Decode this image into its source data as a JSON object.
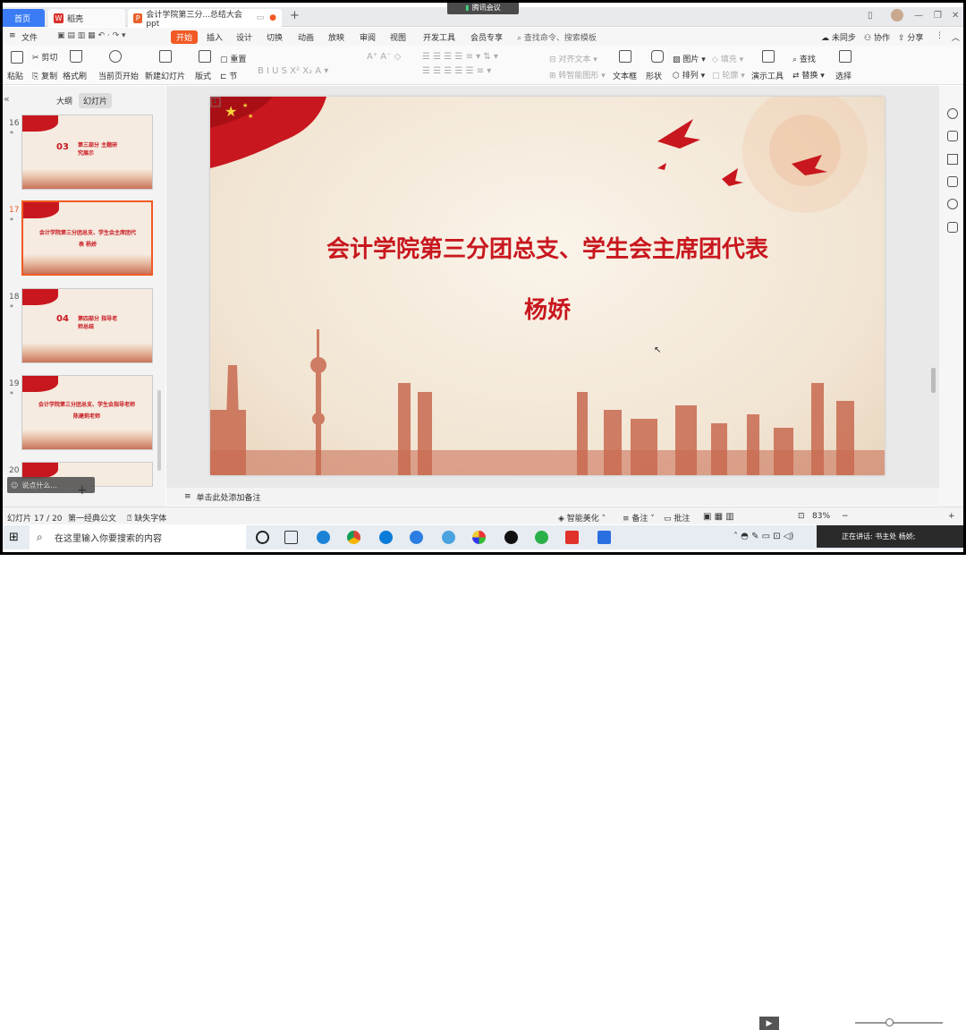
{
  "tabs": {
    "home": "首页",
    "wps": "稻壳",
    "doc": "会计学院第三分...总结大会ppt"
  },
  "meeting_label": "腾讯会议",
  "menu": [
    "文件",
    "开始",
    "插入",
    "设计",
    "切换",
    "动画",
    "放映",
    "审阅",
    "视图",
    "开发工具",
    "会员专享"
  ],
  "menu_search": "查找命令、搜索模板",
  "menu_right": {
    "sync": "未同步",
    "collab": "协作",
    "share": "分享"
  },
  "ribbon": {
    "paste": "粘贴",
    "cut": "剪切",
    "copy": "复制",
    "format_painter": "格式刷",
    "from_current": "当前页开始",
    "new_slide": "新建幻灯片",
    "layout": "版式",
    "section": "节",
    "reset": "重置",
    "align_text": "对齐文本",
    "convert_smartart": "转智能图形",
    "textbox": "文本框",
    "shape": "形状",
    "arrange": "排列",
    "picture": "图片",
    "fill": "填充",
    "outline": "轮廓",
    "presentation_tools": "演示工具",
    "find": "查找",
    "replace": "替换",
    "select": "选择"
  },
  "panel_tabs": {
    "outline": "大纲",
    "slides": "幻灯片"
  },
  "thumbnails": [
    {
      "num": "16",
      "star": "*",
      "badge": "03",
      "text": "第三部分 主题研究展示"
    },
    {
      "num": "17",
      "star": "*",
      "text": "会计学院第三分团总支、学生会主席团代表 杨娇"
    },
    {
      "num": "18",
      "star": "*",
      "badge": "04",
      "text": "第四部分 指导老师总结"
    },
    {
      "num": "19",
      "star": "*",
      "text": "会计学院第三分团总支、学生会指导老师 陈建莉老师"
    },
    {
      "num": "20",
      "star": "",
      "text": ""
    }
  ],
  "comment_placeholder": "说点什么...",
  "slide": {
    "page_label": "1",
    "title": "会计学院第三分团总支、学生会主席团代表",
    "name": "杨娇"
  },
  "notes_placeholder": "单击此处添加备注",
  "status": {
    "slide_count": "幻灯片 17 / 20",
    "theme": "第一经典公文",
    "missing_font": "缺失字体",
    "beautify": "智能美化",
    "notes": "备注",
    "comments": "批注",
    "zoom": "83%"
  },
  "taskbar": {
    "search_placeholder": "在这里输入你要搜索的内容",
    "notif_text": "正在讲话: 书主处 杨娇;"
  },
  "colors": {
    "accent": "#f15a24",
    "slide_red": "#c8171e",
    "home_blue": "#3b7cf6"
  }
}
